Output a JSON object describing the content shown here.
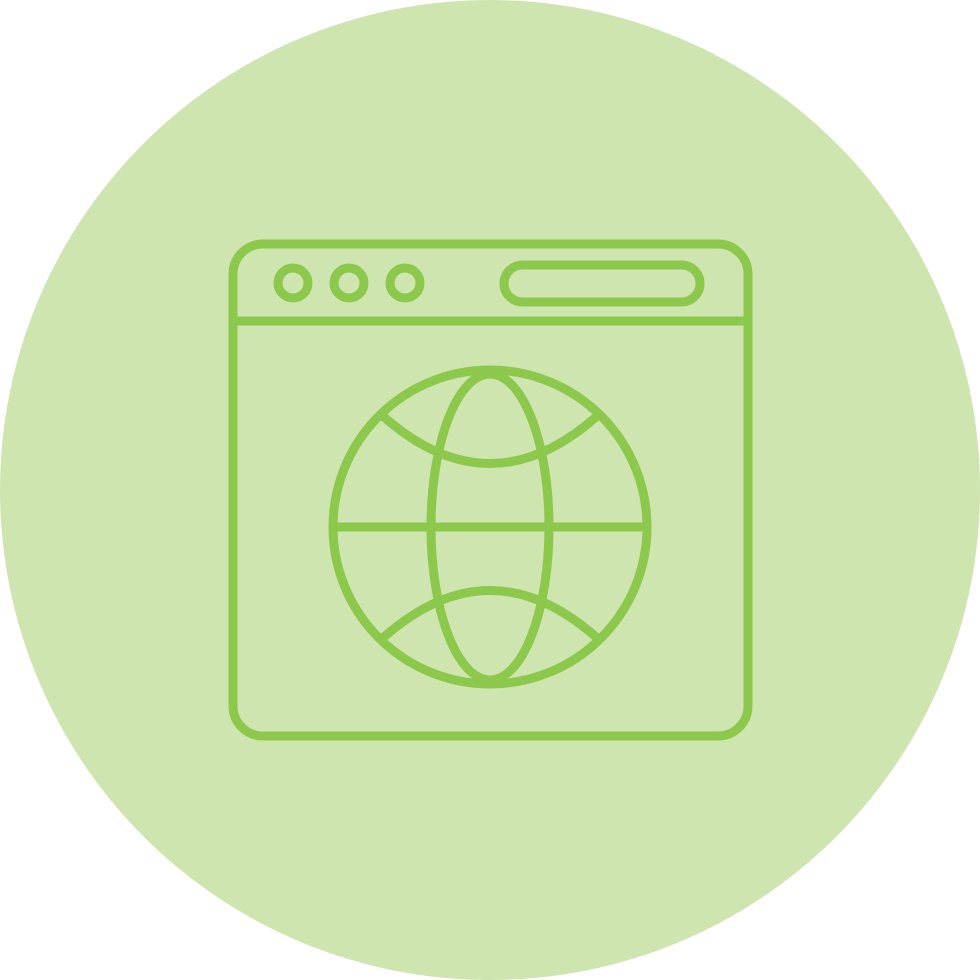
{
  "icon": {
    "name": "web-browser-globe-icon",
    "style": "outline",
    "colors": {
      "background_circle": "#cfe5b0",
      "stroke": "#8cc84b",
      "page_background": "#ffffff"
    }
  }
}
